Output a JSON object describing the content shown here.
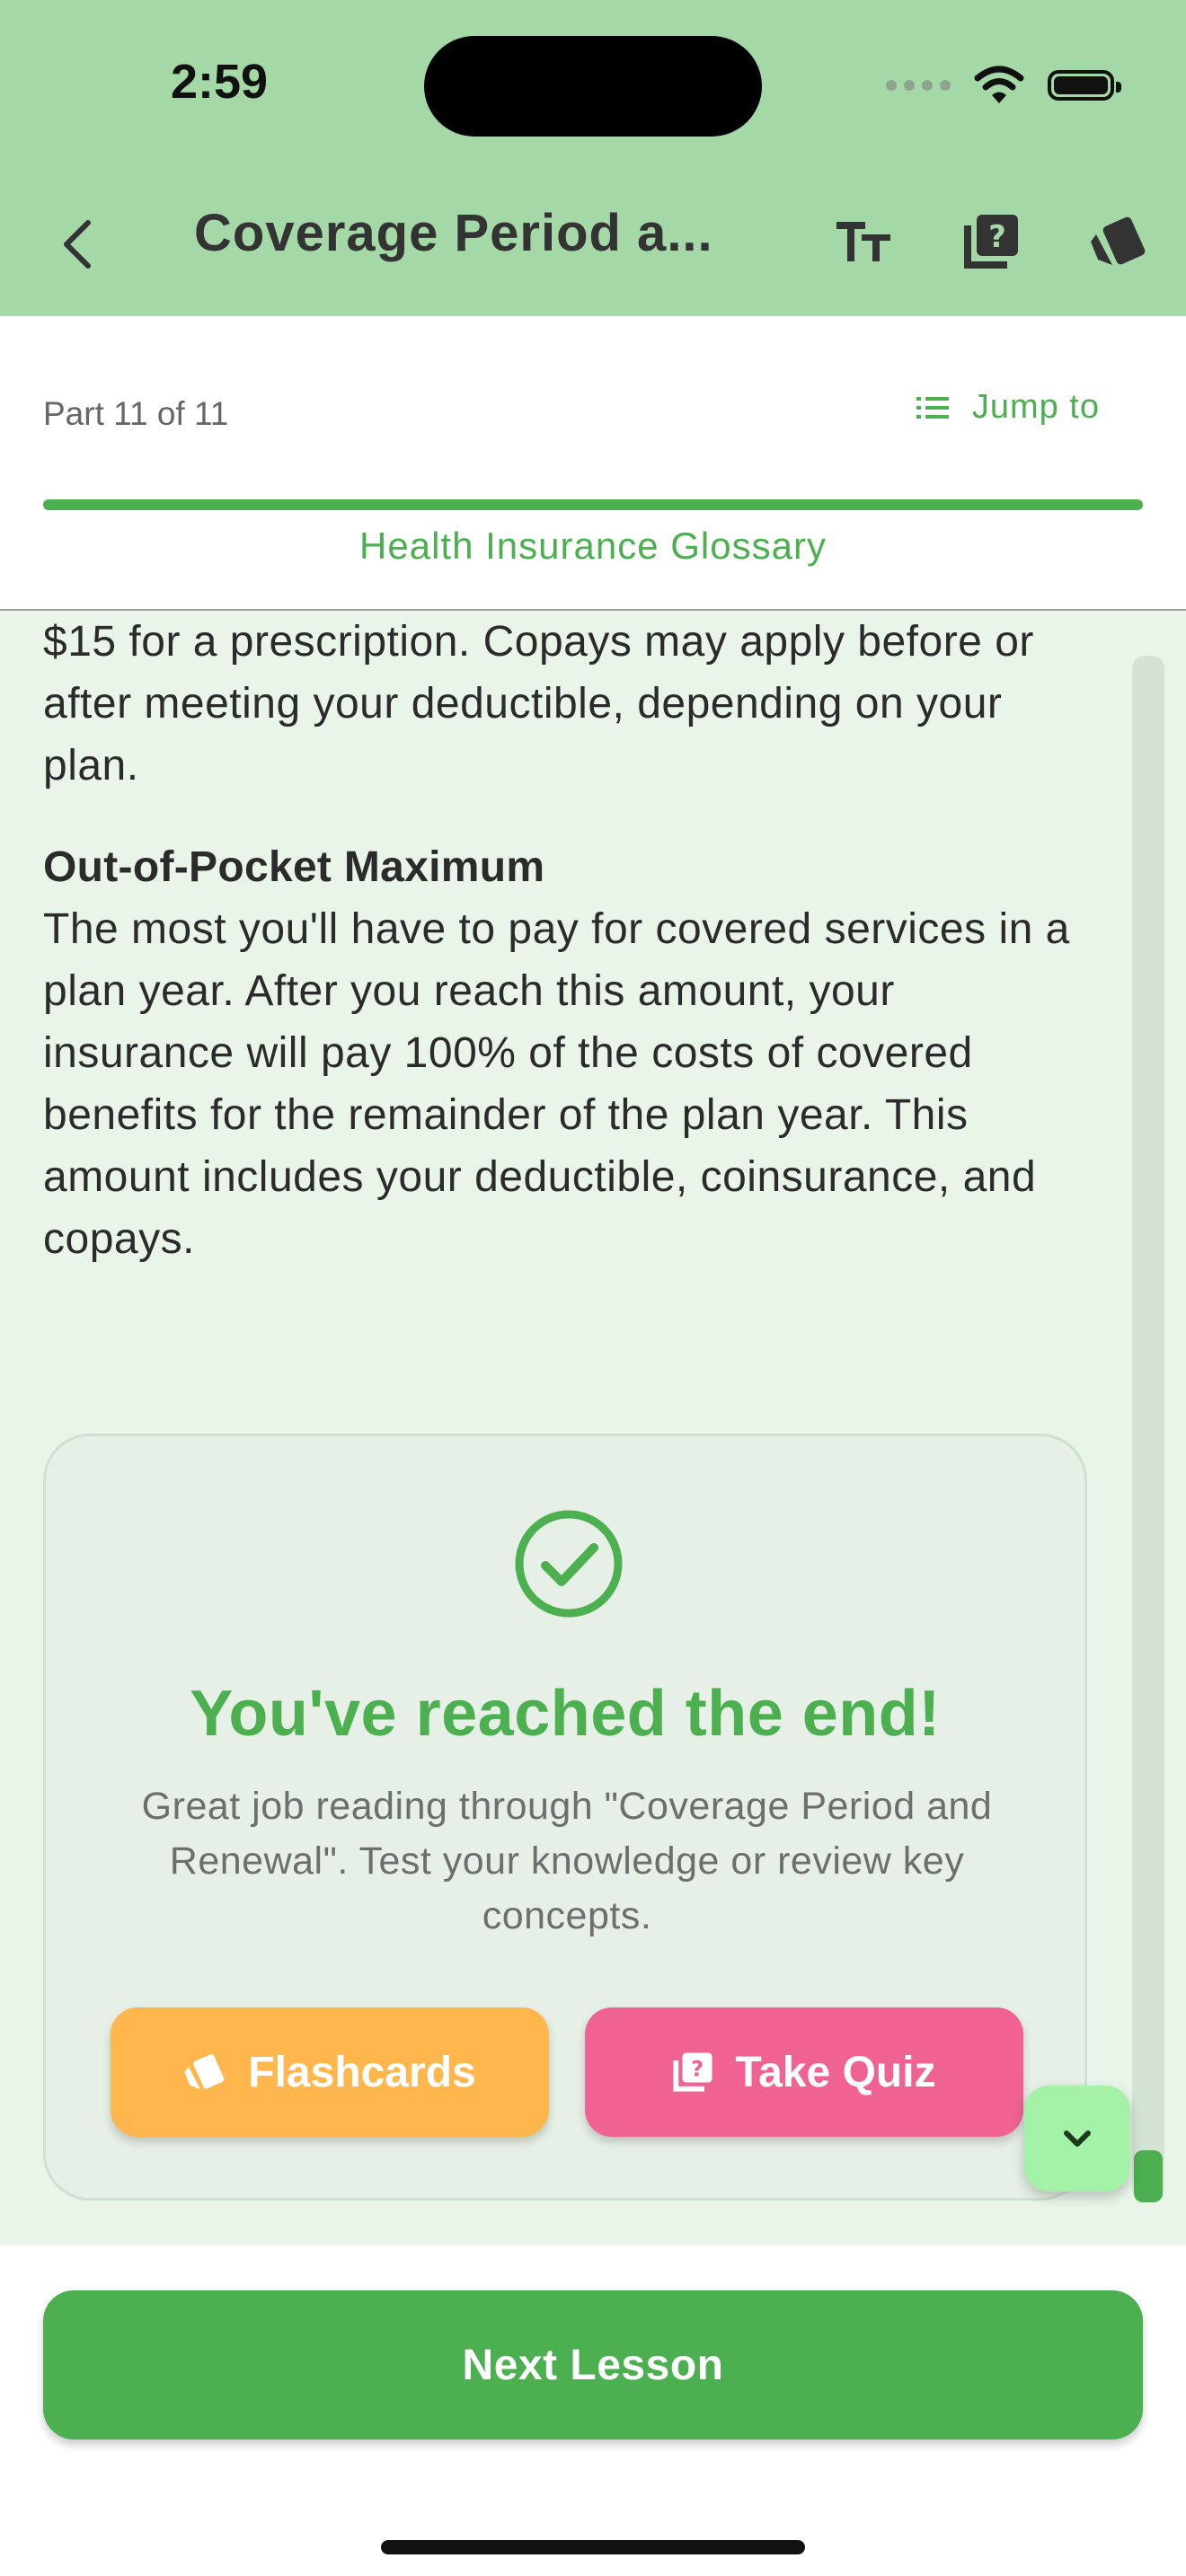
{
  "status_bar": {
    "time": "2:59"
  },
  "nav": {
    "title": "Coverage Period a...",
    "icons": [
      "chevron-left-icon",
      "text-size-icon",
      "quiz-icon",
      "flashcards-icon"
    ]
  },
  "header": {
    "part_label": "Part 11 of 11",
    "jump_to_label": "Jump to",
    "progress_fraction": 1.0,
    "course_name": "Health Insurance Glossary"
  },
  "content": {
    "partial_paragraph": "$15 for a prescription. Copays may apply before or after meeting your deductible, depending on your plan.",
    "term": {
      "title": "Out-of-Pocket Maximum",
      "body": "The most you'll have to pay for covered services in a plan year. After you reach this amount, your insurance will pay 100% of the costs of covered benefits for the remainder of the plan year. This amount includes your deductible, coinsurance, and copays."
    }
  },
  "end_card": {
    "title": "You've reached the end!",
    "description": "Great job reading through \"Coverage Period and Renewal\". Test your knowledge or review key concepts.",
    "flashcards_label": "Flashcards",
    "quiz_label": "Take Quiz"
  },
  "footer": {
    "next_label": "Next Lesson"
  },
  "colors": {
    "brand_green": "#4caf50",
    "topbar": "#a5d8a7",
    "flashcards": "#ffb74d",
    "quiz": "#f06292",
    "fab": "#a3f2a8"
  }
}
